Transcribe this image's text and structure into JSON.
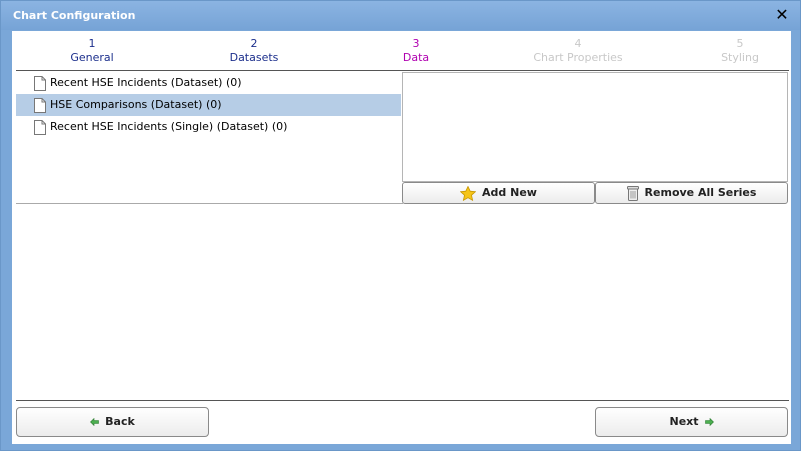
{
  "window": {
    "title": "Chart Configuration"
  },
  "steps": [
    {
      "num": "1",
      "label": "General",
      "state": "done"
    },
    {
      "num": "2",
      "label": "Datasets",
      "state": "done"
    },
    {
      "num": "3",
      "label": "Data",
      "state": "active"
    },
    {
      "num": "4",
      "label": "Chart Properties",
      "state": "disabled"
    },
    {
      "num": "5",
      "label": "Styling",
      "state": "disabled"
    }
  ],
  "datasets": [
    {
      "label": "Recent HSE Incidents (Dataset) (0)",
      "selected": false,
      "icon": "document-icon"
    },
    {
      "label": "HSE Comparisons (Dataset) (0)",
      "selected": true,
      "icon": "document-icon"
    },
    {
      "label": "Recent HSE Incidents (Single) (Dataset) (0)",
      "selected": false,
      "icon": "document-icon"
    }
  ],
  "series_actions": {
    "add_new": "Add New",
    "add_icon": "star-icon",
    "remove_all": "Remove All Series",
    "remove_icon": "trash-icon"
  },
  "footer": {
    "back": "Back",
    "next": "Next"
  },
  "colors": {
    "titlebar": "#7aa7d8",
    "step_done": "#1c2f8c",
    "step_active": "#b000b0",
    "step_disabled": "#c8c8c8",
    "selected_row": "#b6cde6"
  }
}
